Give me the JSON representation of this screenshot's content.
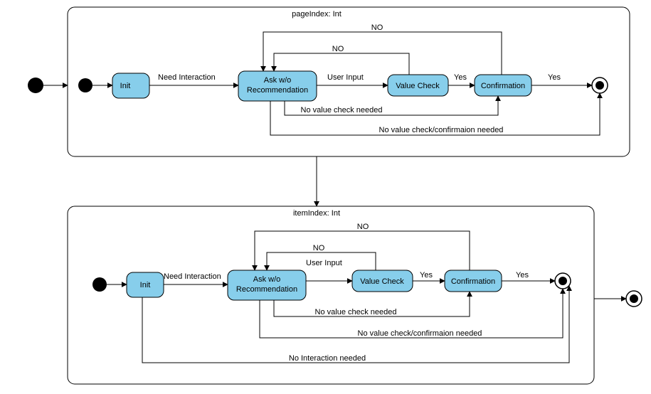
{
  "containers": {
    "top": {
      "title": "pageIndex: Int"
    },
    "bottom": {
      "title": "itemIndex: Int"
    }
  },
  "states": {
    "init": "Init",
    "ask": "Ask w/o\nRecommendation",
    "valueCheck": "Value Check",
    "confirmation": "Confirmation"
  },
  "labels": {
    "needInteraction": "Need Interaction",
    "userInput": "User Input",
    "yes": "Yes",
    "no": "NO",
    "noValueCheckNeeded": "No value check needed",
    "noValueCheckConfirmNeeded": "No value check/confirmaion needed",
    "noInteractionNeeded": "No Interaction needed"
  }
}
